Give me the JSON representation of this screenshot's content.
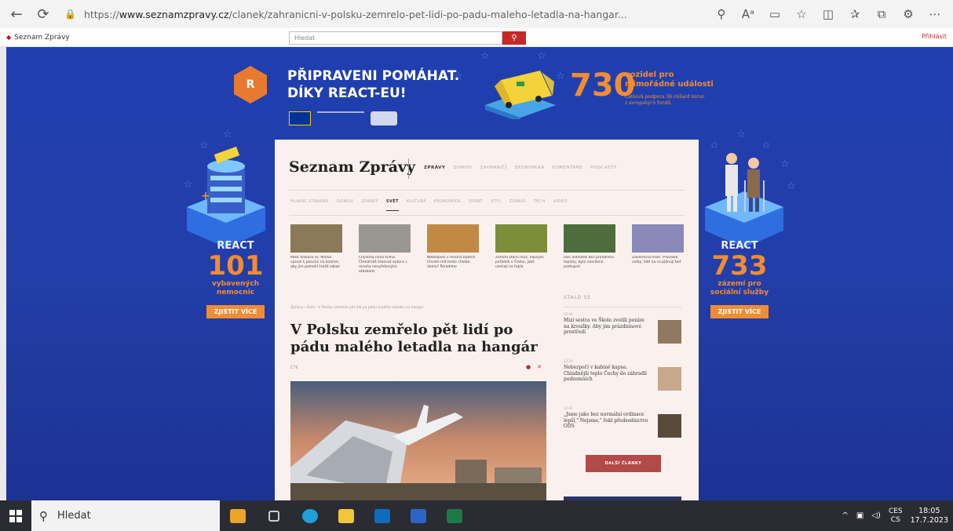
{
  "browser": {
    "url_prefix": "https://",
    "url_host": "www.seznamzpravy.cz",
    "url_path": "/clanek/zahranicni-v-polsku-zemrelo-pet-lidi-po-padu-maleho-letadla-na-hangar...",
    "reader_label": "Aᵃ"
  },
  "seznam_toolbar": {
    "left_label": "Seznam Zprávy",
    "search_placeholder": "Hledat",
    "right_label": "Přihlásit"
  },
  "ad": {
    "logo_letter": "R",
    "headline_1": "PŘIPRAVENI POMÁHAT.",
    "headline_2": "DÍKY REACT-EU!",
    "big_number": "730",
    "big_text_1": "vozidel pro",
    "big_text_2": "mimořádné události",
    "big_sub_1": "Celková podpora 36 miliard korun",
    "big_sub_2": "z evropských fondů",
    "left_react": "REACT",
    "left_number": "101",
    "left_text_1": "vybavených",
    "left_text_2": "nemocnic",
    "left_button": "ZJISTIT VÍCE",
    "right_react": "REACT",
    "right_number": "733",
    "right_text_1": "zázemí pro",
    "right_text_2": "sociální služby",
    "right_button": "ZJISTIT VÍCE"
  },
  "site": {
    "brand": "Seznam Zprávy",
    "top_nav": [
      "ZPRÁVY",
      "DOMOV",
      "ZAHRANIČÍ",
      "EKONOMIKA",
      "KOMENTÁŘE",
      "PODCASTY"
    ],
    "section_nav": [
      "HLAVNÍ STRÁNKA",
      "DOMOV",
      "ZPRÁVY",
      "SVĚT",
      "KULTURA",
      "EKONOMIKA",
      "SPORT",
      "STYL",
      "ZDRAVÍ",
      "TECH",
      "VIDEO"
    ],
    "section_active_index": 3,
    "thumbs": [
      {
        "caption": "Mistr diskuse sv. Marka vyzval k posunu na komise, aby jim pomohl zrušit zákaz",
        "color": "#8a7a58"
      },
      {
        "caption": "Chystala nová kniha. Čtenářské šokovat autora s mnoha nevyřešenými otázkami",
        "color": "#9a9690"
      },
      {
        "caption": "Nebezpečí v mnoha bytech. Chcete mít tento chleba doma? Poradíme",
        "color": "#c08a45"
      },
      {
        "caption": "Zemřel starší muž, nejvyšší pořádek v Česku, jaké umírají na teplo",
        "color": "#7d8e3a"
      },
      {
        "caption": "Den jednotek bez přírodního teploty, bylo navrženo postupně",
        "color": "#4d6d3c"
      },
      {
        "caption": "Závěrečná mise. Pravdivé volby, lidé na co plánují teď",
        "color": "#8a8ab8"
      }
    ],
    "breadcrumb": "Zprávy  ›  Svět  ›  V Polsku zemřelo pět lidí po pádu malého letadla na hangár",
    "title": "V Polsku zemřelo pět lidí po pádu malého letadla na hangár",
    "meta": "ČTK",
    "share_icons": [
      "●",
      "✕"
    ],
    "stalo_heading": "STALO SE",
    "stalo": [
      {
        "time": "12:40",
        "title": "Mizí sestra ve Škole zvolili peníze na kroužky. Aby jim prázdninové prostředí"
      },
      {
        "time": "12:20",
        "title": "Nebezpečí v kabině kapsa. Chladnější teplo Čechy do zábradlí podzemních"
      },
      {
        "time": "12:03",
        "title": "„Jsme jako bez normální ordinace lepší,\" Nejsme,\" řekl předsednictvo ODS"
      }
    ],
    "more_button": "DALŠÍ ČLÁNKY"
  },
  "taskbar": {
    "search_label": "Hledat",
    "lang_1": "CES",
    "lang_2": "CS",
    "time": "18:05",
    "date": "17.7.2023"
  }
}
